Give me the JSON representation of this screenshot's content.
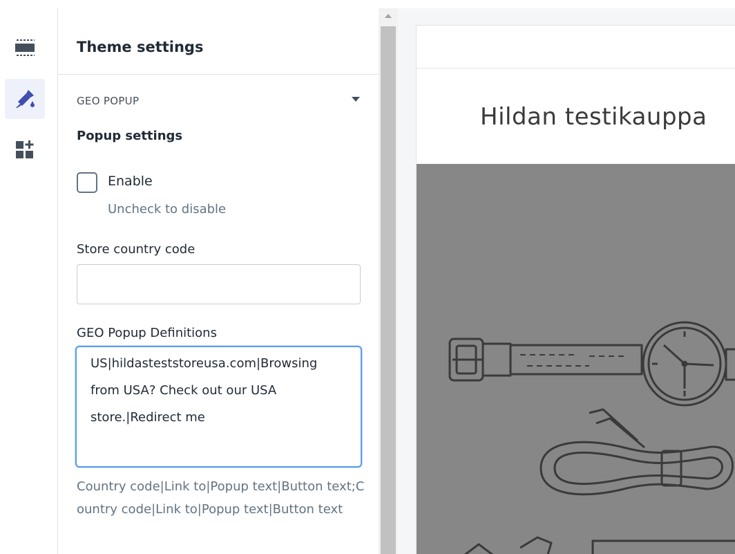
{
  "rail": {
    "items": [
      {
        "icon": "sections-icon",
        "active": false
      },
      {
        "icon": "theme-settings-brush-icon",
        "active": true
      },
      {
        "icon": "add-apps-icon",
        "active": false
      }
    ],
    "accent": "#3f4eae"
  },
  "panel": {
    "title": "Theme settings",
    "section": {
      "label": "GEO POPUP",
      "subheading": "Popup settings",
      "enable": {
        "label": "Enable",
        "checked": false,
        "help": "Uncheck to disable"
      },
      "country_code": {
        "label": "Store country code",
        "value": ""
      },
      "definitions": {
        "label": "GEO Popup Definitions",
        "value": "US|hildasteststoreusa.com|Browsing from USA? Check out our USA store.|Redirect me",
        "help": "Country code|Link to|Popup text|Button text;Country code|Link to|Popup text|Button text"
      }
    }
  },
  "preview": {
    "store_name": "Hildan testikauppa"
  },
  "colors": {
    "focus_border": "#5c9dea",
    "hero_gray": "#878787",
    "help_text": "#637381"
  }
}
